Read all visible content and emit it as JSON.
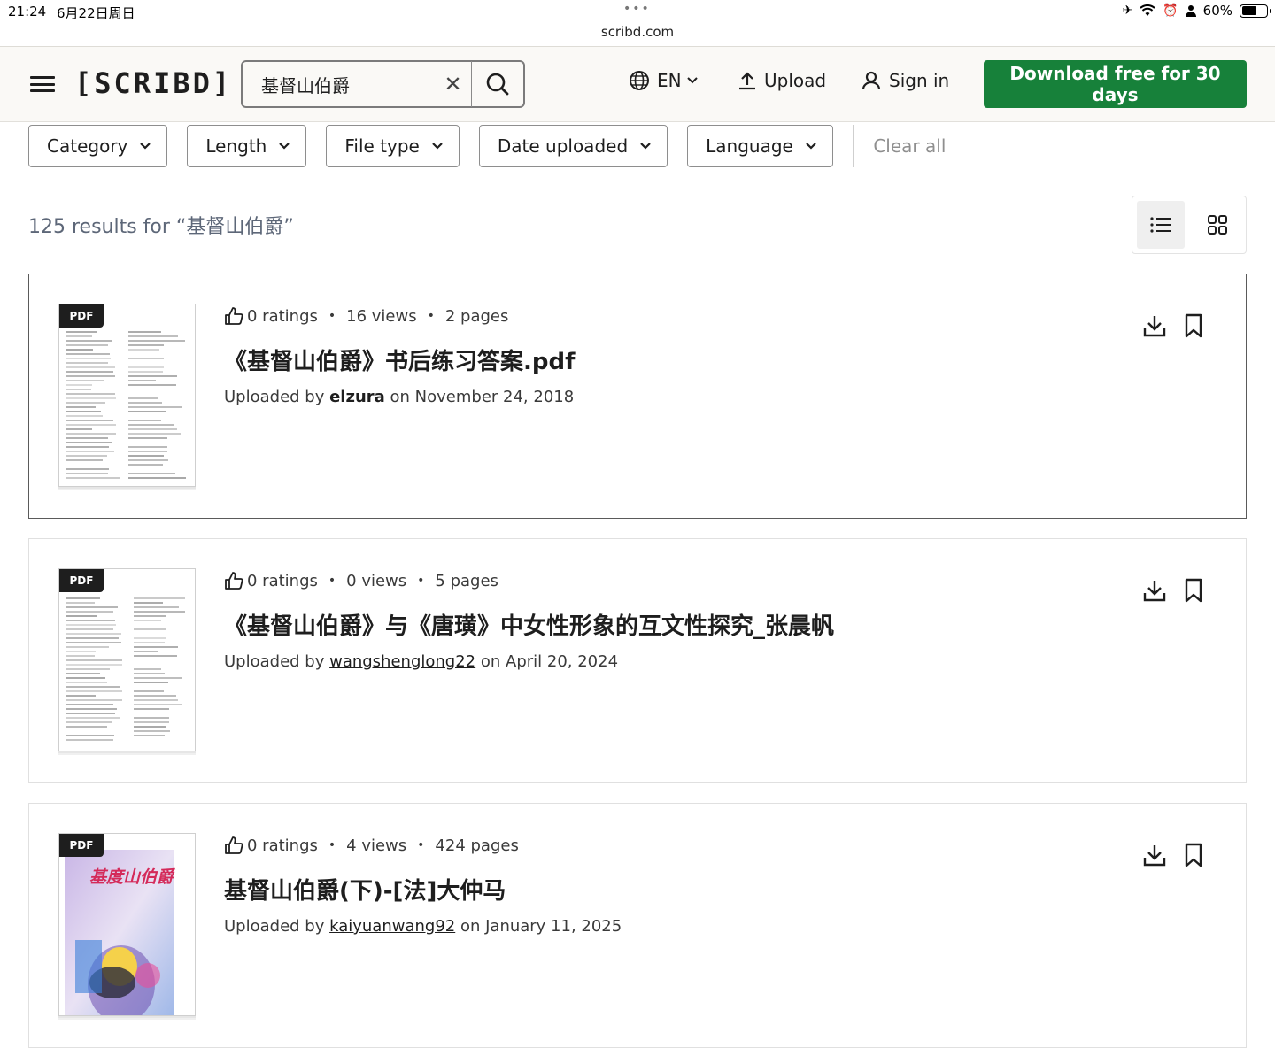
{
  "status_bar": {
    "time": "21:24",
    "date": "6月22日周日",
    "url": "scribd.com",
    "battery": "60%",
    "battery_level": 0.6
  },
  "header": {
    "logo": "[SCRIBD]",
    "search_value": "基督山伯爵",
    "language": "EN",
    "upload": "Upload",
    "sign_in": "Sign in",
    "cta": "Download free for 30 days"
  },
  "filters": {
    "items": [
      "Category",
      "Length",
      "File type",
      "Date uploaded",
      "Language"
    ],
    "clear_all": "Clear all"
  },
  "results": {
    "count_text": "125 results for “基督山伯爵”",
    "items": [
      {
        "badge": "PDF",
        "ratings": "0 ratings",
        "views": "16 views",
        "pages": "2 pages",
        "title": "《基督山伯爵》书后练习答案.pdf",
        "uploaded_prefix": "Uploaded by ",
        "uploader": "elzura",
        "uploaded_suffix": " on November 24, 2018"
      },
      {
        "badge": "PDF",
        "ratings": "0 ratings",
        "views": "0 views",
        "pages": "5 pages",
        "title": "《基督山伯爵》与《唐璜》中女性形象的互文性探究_张晨帆",
        "uploaded_prefix": "Uploaded by ",
        "uploader": "wangshenglong22",
        "uploaded_suffix": " on April 20, 2024"
      },
      {
        "badge": "PDF",
        "ratings": "0 ratings",
        "views": "4 views",
        "pages": "424 pages",
        "title": "基督山伯爵(下)-[法]大仲马",
        "uploaded_prefix": "Uploaded by ",
        "uploader": "kaiyuanwang92",
        "uploaded_suffix": " on January 11, 2025",
        "cover_text": "基度山伯爵"
      }
    ]
  },
  "colors": {
    "cta": "#17813a",
    "results_text": "#5d6778"
  }
}
